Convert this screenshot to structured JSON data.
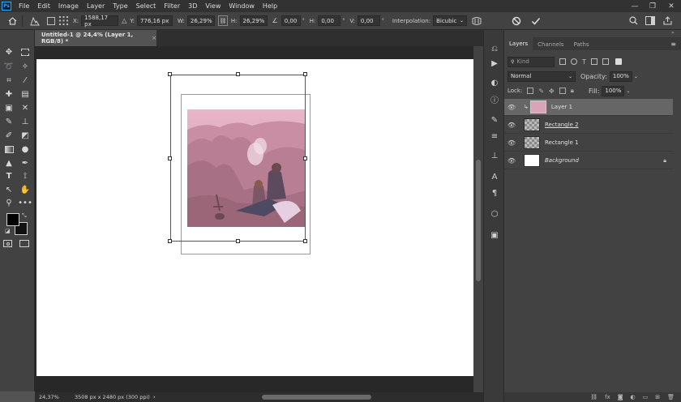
{
  "app": {
    "logo": "Ps"
  },
  "menu": [
    "File",
    "Edit",
    "Image",
    "Layer",
    "Type",
    "Select",
    "Filter",
    "3D",
    "View",
    "Window",
    "Help"
  ],
  "window_controls": {
    "minimize": "—",
    "restore": "❐",
    "close": "✕"
  },
  "options_bar": {
    "x_label": "X:",
    "x_value": "1588,17 px",
    "y_label": "Y:",
    "y_value": "776,16 px",
    "w_label": "W:",
    "w_value": "26,29%",
    "link_label": "⛓",
    "h_label": "H:",
    "h_value": "26,29%",
    "angle_value": "0,00",
    "hskew_label": "H:",
    "hskew_value": "0,00",
    "vskew_label": "V:",
    "vskew_value": "0,00",
    "interp_label": "Interpolation:",
    "interp_value": "Bicubic"
  },
  "document": {
    "tab_title": "Untitled-1 @ 24,4% (Layer 1, RGB/8) *",
    "tab_close": "×"
  },
  "status": {
    "zoom": "24,37%",
    "doc_info": "3508 px x 2480 px (300 ppi)"
  },
  "layers_panel": {
    "tabs": [
      "Layers",
      "Channels",
      "Paths"
    ],
    "filter_placeholder": "Kind",
    "blend_mode": "Normal",
    "opacity_label": "Opacity:",
    "opacity_value": "100%",
    "lock_label": "Lock:",
    "fill_label": "Fill:",
    "fill_value": "100%",
    "layers": [
      {
        "name": "Layer 1"
      },
      {
        "name": "Rectangle 2"
      },
      {
        "name": "Rectangle 1"
      },
      {
        "name": "Background"
      }
    ]
  },
  "colors": {
    "accent": "#31a8ff",
    "foreground": "#000000",
    "background": "#ffffff"
  }
}
